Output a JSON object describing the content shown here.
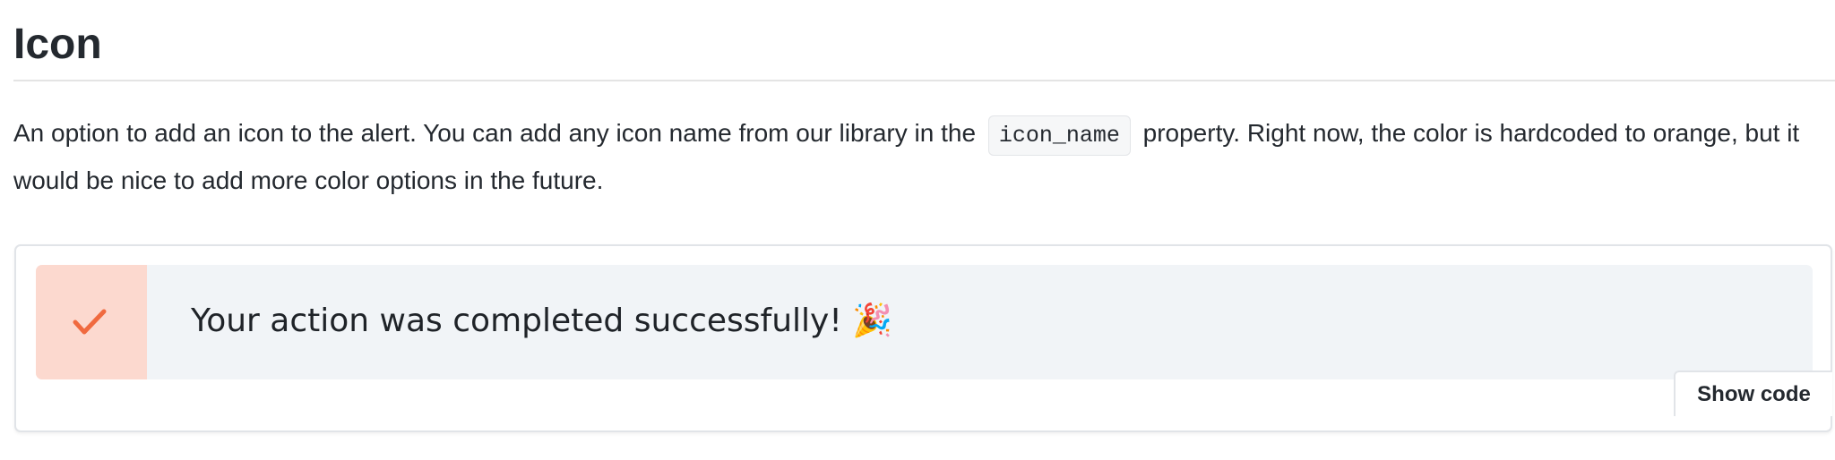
{
  "section": {
    "title": "Icon",
    "description_before": "An option to add an icon to the alert. You can add any icon name from our library in the",
    "code_token": "icon_name",
    "description_after": "property. Right now, the color is hardcoded to orange, but it would be nice to add more color options in the future."
  },
  "demo": {
    "alert": {
      "icon": "checkmark-icon",
      "icon_color": "#f06a3f",
      "icon_background": "#fcd9cf",
      "background": "#f1f4f7",
      "message": "Your action was completed successfully! 🎉"
    },
    "show_code_label": "Show code"
  }
}
